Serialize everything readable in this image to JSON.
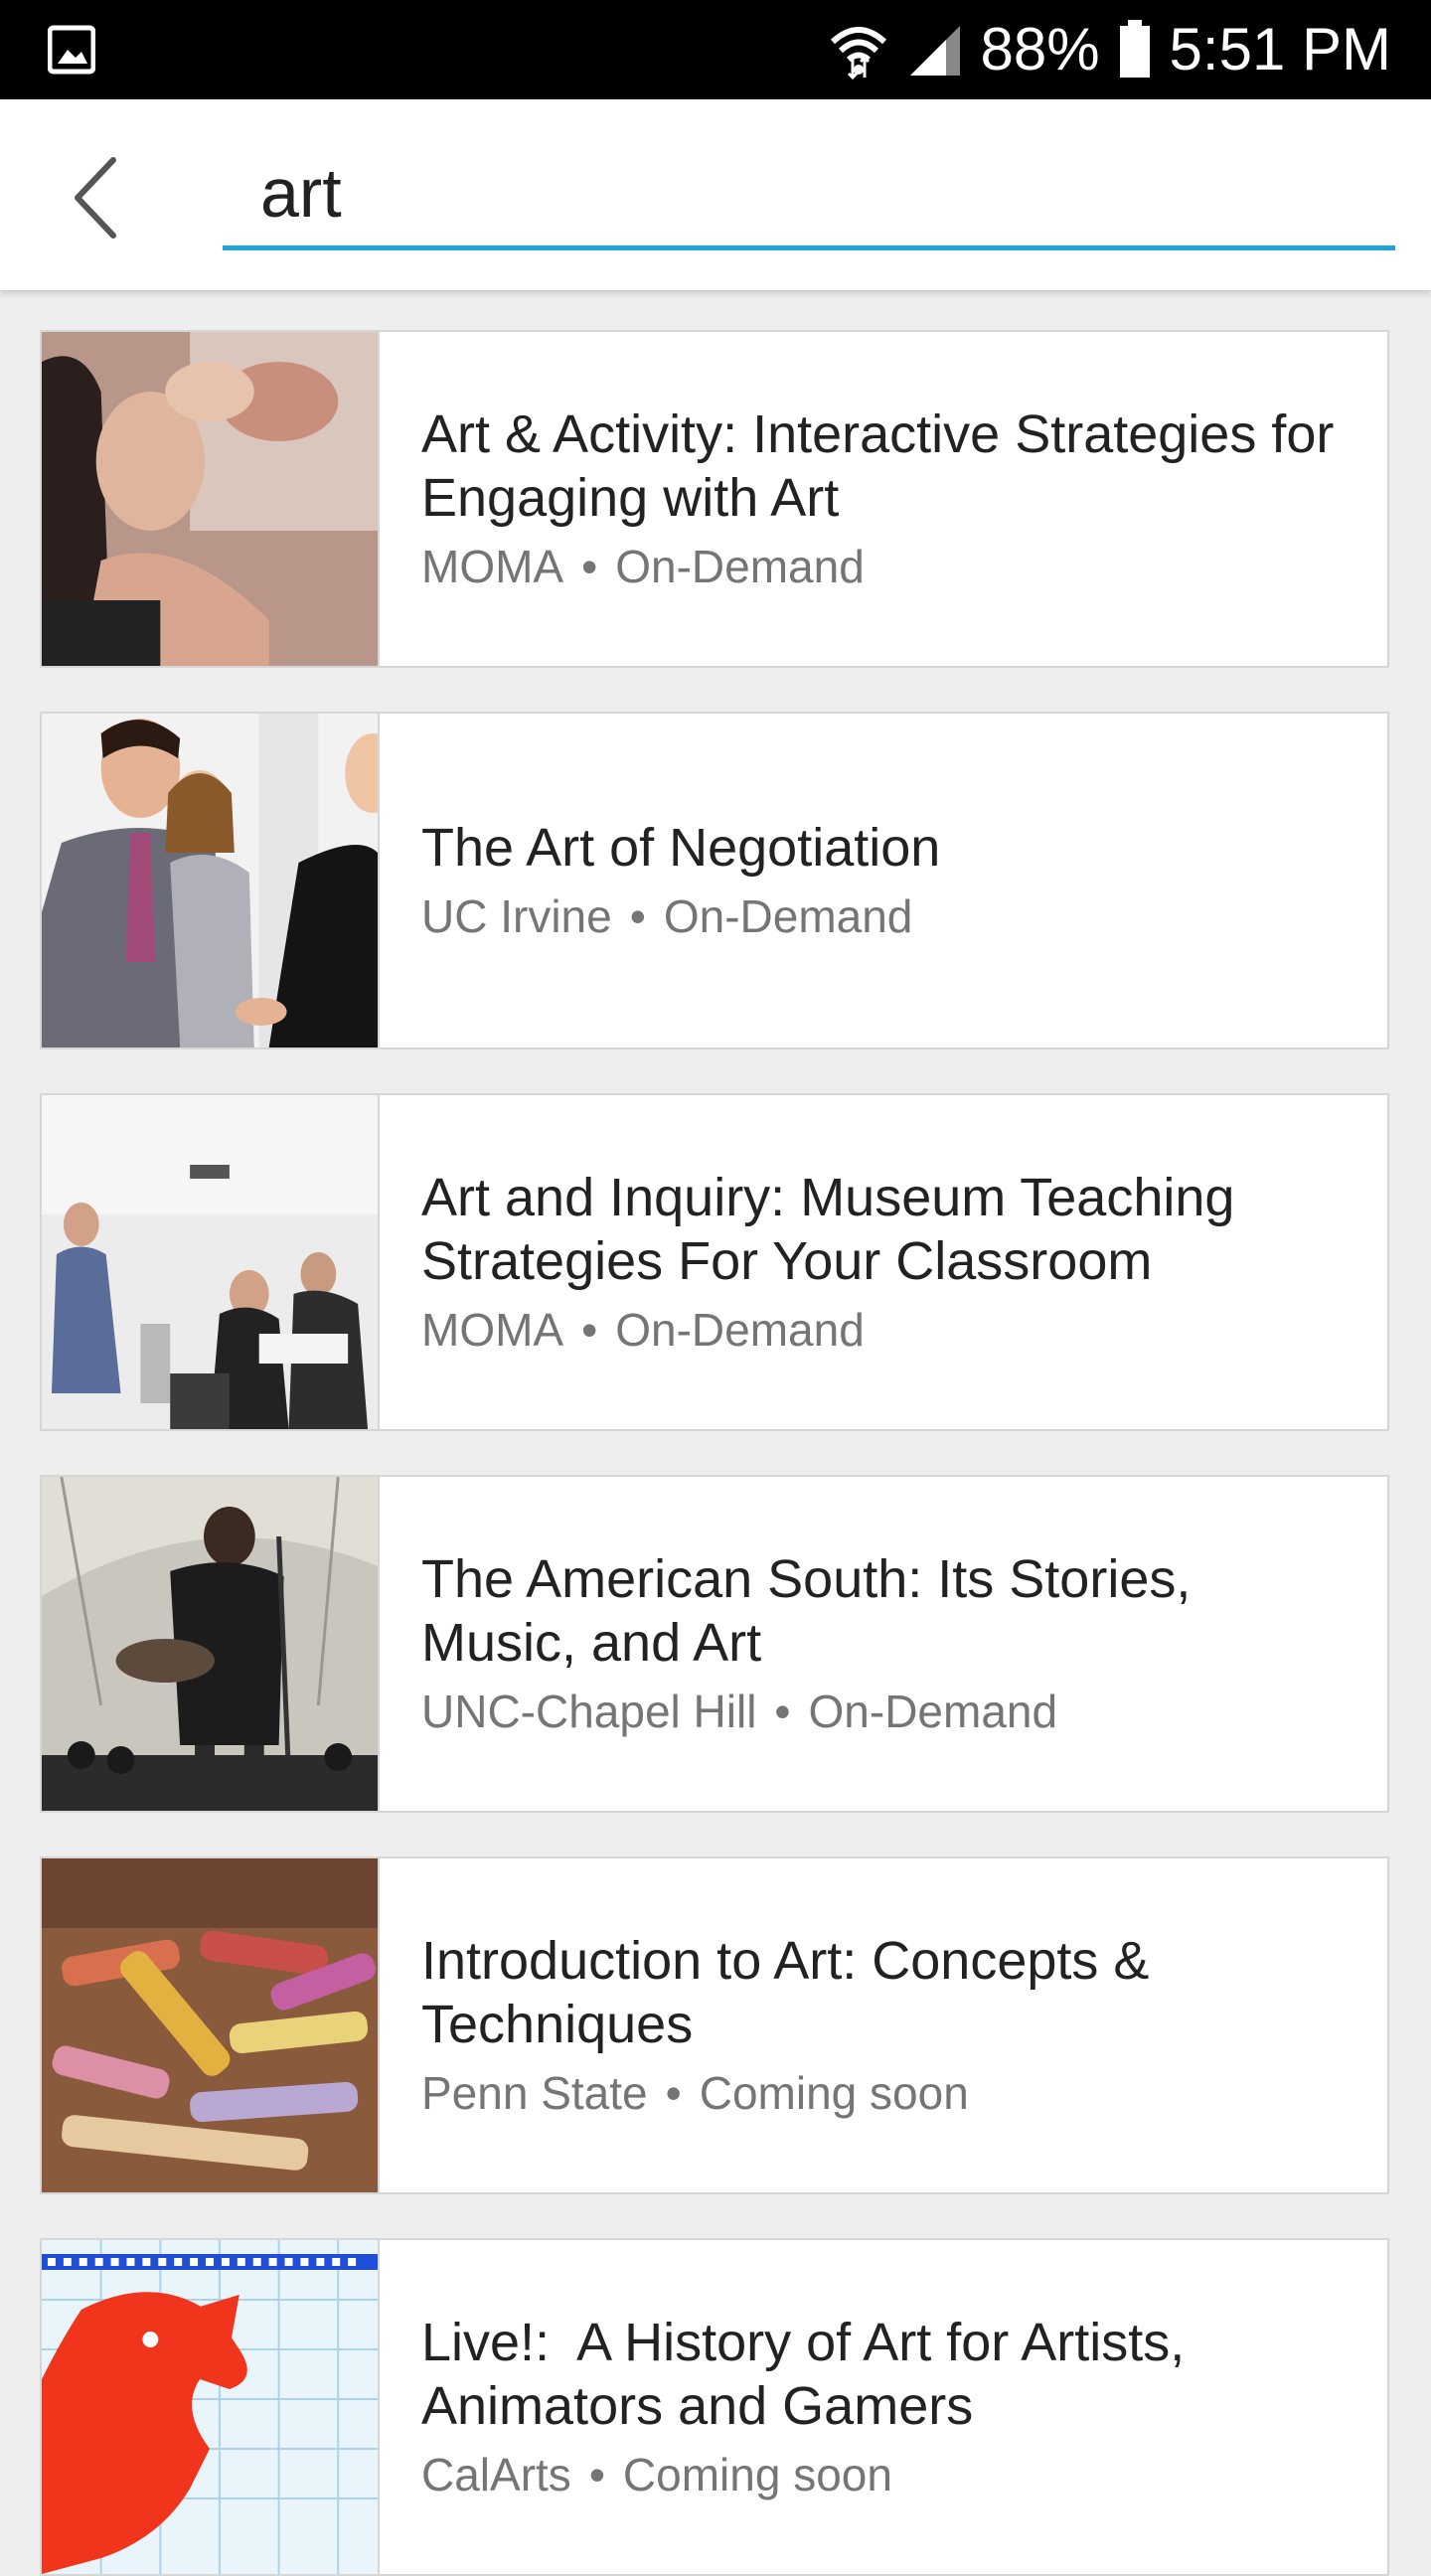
{
  "status_bar": {
    "battery": "88%",
    "time": "5:51 PM",
    "icons": [
      "image-notification-icon",
      "wifi-icon",
      "cell-signal-icon",
      "battery-icon"
    ]
  },
  "search": {
    "value": "art",
    "accent_color": "#1fa3d9"
  },
  "results": [
    {
      "title": "Art & Activity: Interactive Strategies for Engaging with Art",
      "provider": "MOMA",
      "availability": "On-Demand"
    },
    {
      "title": "The Art of Negotiation",
      "provider": "UC Irvine",
      "availability": "On-Demand"
    },
    {
      "title": "Art and Inquiry: Museum Teaching Strategies For Your Classroom",
      "provider": "MOMA",
      "availability": "On-Demand"
    },
    {
      "title": "The American South: Its Stories, Music, and Art",
      "provider": "UNC-Chapel Hill",
      "availability": "On-Demand"
    },
    {
      "title": "Introduction to Art: Concepts & Techniques",
      "provider": "Penn State",
      "availability": "Coming soon"
    },
    {
      "title": "Live!:  A History of Art for Artists, Animators and Gamers",
      "provider": "CalArts",
      "availability": "Coming soon"
    }
  ],
  "separator": "•"
}
